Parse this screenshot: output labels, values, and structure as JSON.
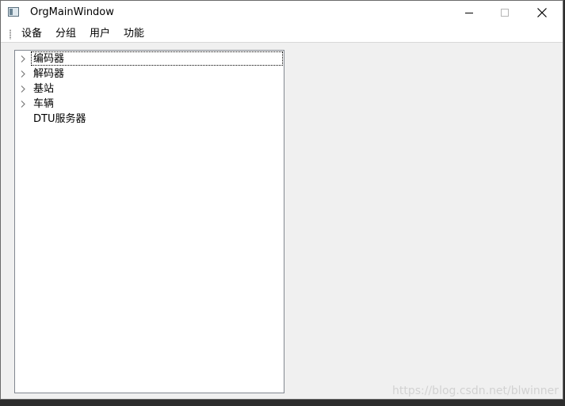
{
  "window": {
    "title": "OrgMainWindow",
    "icon": "app-window-icon"
  },
  "menubar": {
    "items": [
      "设备",
      "分组",
      "用户",
      "功能"
    ]
  },
  "tree": {
    "items": [
      {
        "label": "编码器",
        "expandable": true,
        "focused": true
      },
      {
        "label": "解码器",
        "expandable": true,
        "focused": false
      },
      {
        "label": "基站",
        "expandable": true,
        "focused": false
      },
      {
        "label": "车辆",
        "expandable": true,
        "focused": false
      },
      {
        "label": "DTU服务器",
        "expandable": false,
        "focused": false
      }
    ]
  },
  "watermark": "https://blog.csdn.net/blwinner"
}
